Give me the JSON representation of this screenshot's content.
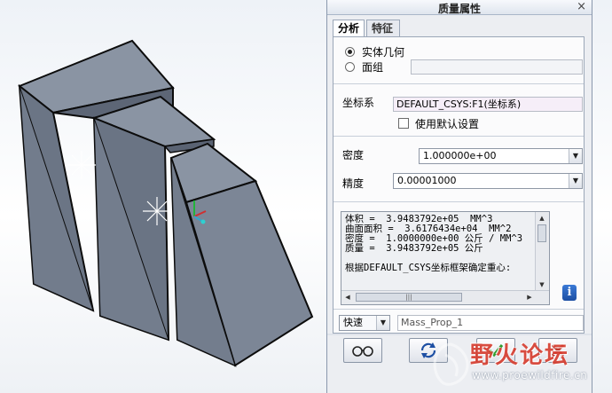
{
  "dialog": {
    "title": "质量属性",
    "close_glyph": "×",
    "tabs": [
      {
        "label": "分析"
      },
      {
        "label": "特征"
      }
    ],
    "geometry": {
      "options": [
        {
          "label": "实体几何",
          "selected": true
        },
        {
          "label": "面组",
          "selected": false
        }
      ],
      "quilt_value": ""
    },
    "coord": {
      "label": "坐标系",
      "value": "DEFAULT_CSYS:F1(坐标系)",
      "default_label": "使用默认设置",
      "default_checked": false
    },
    "density": {
      "label": "密度",
      "value": "1.000000e+00"
    },
    "precision": {
      "label": "精度",
      "value": "0.00001000"
    },
    "results_text": "体积 =  3.9483792e+05  MM^3\n曲面面积 =  3.6176434e+04  MM^2\n密度 =  1.0000000e+00 公斤 / MM^3\n质量 =  3.9483792e+05 公斤\n\n根据DEFAULT_CSYS坐标框架确定重心:",
    "mode": {
      "value": "快速"
    },
    "name_value": "Mass_Prop_1",
    "buttons": [
      {
        "name": "preview-button",
        "icon": "glasses-icon"
      },
      {
        "name": "repaint-button",
        "icon": "repaint-icon"
      },
      {
        "name": "ok-button",
        "icon": "checkmark-icon"
      },
      {
        "name": "cancel-button",
        "icon": "cross-icon"
      }
    ],
    "info_glyph": "i"
  },
  "watermark": {
    "title": "野火论坛",
    "url": "www.proewildfire.cn"
  },
  "colors": {
    "accent": "#3a79d6",
    "ok": "#2e9c2e",
    "cancel": "#c23a2e",
    "model": "#6d7786"
  }
}
